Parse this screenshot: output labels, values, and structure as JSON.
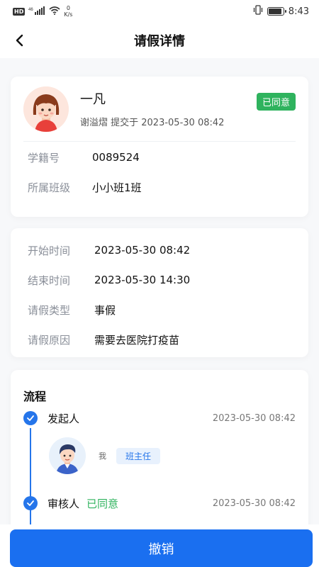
{
  "status_bar": {
    "hd": "HD",
    "signal": "46",
    "speed_value": "0",
    "speed_unit": "K/s",
    "time": "8:43",
    "battery_level": 0.9
  },
  "header": {
    "title": "请假详情",
    "back_icon": "chevron-left-icon"
  },
  "student": {
    "name": "一凡",
    "submitted_by": "谢溢熠 提交于 2023-05-30 08:42",
    "status": "已同意",
    "status_color": "#2fb35e",
    "fields": [
      {
        "label": "学籍号",
        "value": "0089524"
      },
      {
        "label": "所属班级",
        "value": "小小班1班"
      }
    ]
  },
  "leave": {
    "fields": [
      {
        "label": "开始时间",
        "value": "2023-05-30 08:42"
      },
      {
        "label": "结束时间",
        "value": "2023-05-30 14:30"
      },
      {
        "label": "请假类型",
        "value": "事假"
      },
      {
        "label": "请假原因",
        "value": "需要去医院打疫苗"
      }
    ]
  },
  "process": {
    "title": "流程",
    "steps": [
      {
        "label": "发起人",
        "status": "",
        "time": "2023-05-30 08:42",
        "person": "我",
        "role": "班主任"
      },
      {
        "label": "审核人",
        "status": "已同意",
        "time": "2023-05-30 08:42"
      }
    ]
  },
  "actions": {
    "revoke_label": "撤销",
    "primary_color": "#1a6ff0"
  }
}
